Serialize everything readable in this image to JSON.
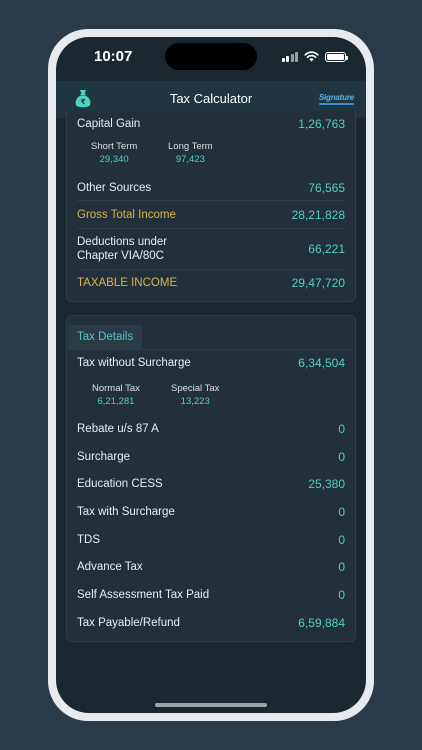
{
  "status_bar": {
    "time": "10:07"
  },
  "app": {
    "title": "Tax Calculator",
    "brand": "Signature"
  },
  "income": {
    "capital_gain_label": "Capital Gain",
    "capital_gain_value": "1,26,763",
    "short_term_label": "Short Term",
    "short_term_value": "29,340",
    "long_term_label": "Long Term",
    "long_term_value": "97,423",
    "other_sources_label": "Other Sources",
    "other_sources_value": "76,565",
    "gross_total_label": "Gross Total Income",
    "gross_total_value": "28,21,828",
    "deductions_label_line1": "Deductions under",
    "deductions_label_line2": "Chapter VIA/80C",
    "deductions_value": "66,221",
    "taxable_income_label": "TAXABLE INCOME",
    "taxable_income_value": "29,47,720"
  },
  "tax_details": {
    "section_label": "Tax Details",
    "tax_without_surcharge_label": "Tax without Surcharge",
    "tax_without_surcharge_value": "6,34,504",
    "normal_tax_label": "Normal Tax",
    "normal_tax_value": "6,21,281",
    "special_tax_label": "Special Tax",
    "special_tax_value": "13,223",
    "rebate_label": "Rebate u/s 87 A",
    "rebate_value": "0",
    "surcharge_label": "Surcharge",
    "surcharge_value": "0",
    "cess_label": "Education CESS",
    "cess_value": "25,380",
    "tax_with_surcharge_label": "Tax with Surcharge",
    "tax_with_surcharge_value": "0",
    "tds_label": "TDS",
    "tds_value": "0",
    "advance_tax_label": "Advance Tax",
    "advance_tax_value": "0",
    "self_assessment_label": "Self Assessment Tax Paid",
    "self_assessment_value": "0",
    "tax_payable_label": "Tax Payable/Refund",
    "tax_payable_value": "6,59,884"
  },
  "colors": {
    "accent": "#4fd0c3",
    "gold": "#d7b54a",
    "background": "#1c2830",
    "app_bar": "#1f3540"
  }
}
